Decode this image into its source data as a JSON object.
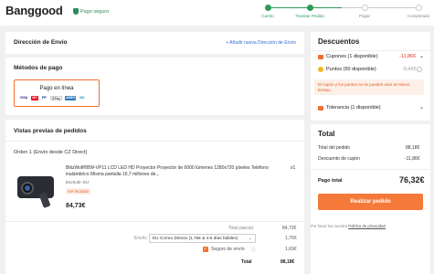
{
  "header": {
    "logo": "Banggood",
    "secure": "Pago seguro",
    "steps": [
      {
        "label": "Carrito",
        "state": "done"
      },
      {
        "label": "Tramitar Pedido",
        "state": "done"
      },
      {
        "label": "Pagar",
        "state": "todo"
      },
      {
        "label": "Completado",
        "state": "todo"
      }
    ]
  },
  "shipping": {
    "title": "Dirección de Envío",
    "add_link": "+ Añadir nueva Dirección de Envío"
  },
  "payment": {
    "title": "Métodos de pago",
    "option": "Pago en línea",
    "logos": [
      "VISA",
      "MC",
      "PP",
      "GPay",
      "AMEX",
      "DC"
    ]
  },
  "preview": {
    "title": "Vistas previas de pedidos",
    "order": "Orden 1 (Envío desde CZ Direct)",
    "product": {
      "name": "BlitzWolf®BW-VP11 LCD LED HD Proyector Proyector de 6000 lúmenes 1280x720 píxeles Teléfono inalámbrico Misma pantalla 16,7 millones de...",
      "qty": "x1",
      "seller": "Enchufe: EU",
      "tax_tag": "IVA incluido",
      "price": "84,73€"
    },
    "subtotal_label": "Total parcial:",
    "subtotal_value": "84,73€",
    "shipping_label": "Envío:",
    "shipping_option": "EU Correo Directo (1,76€ & 4-6 días hábiles)",
    "shipping_value": "1,76€",
    "insurance_label": "Seguro de envío",
    "insurance_value": "1,69€",
    "total_label": "Total",
    "total_value": "88,18€"
  },
  "discounts": {
    "title": "Descuentos",
    "coupons_label": "Cupones (1 disponible)",
    "coupons_value": "-11,86€",
    "points_label": "Puntos (50 disponible)",
    "points_value": "-0,42€",
    "warning": "El cupón y los puntos no se pueden usar al mismo tiempo.",
    "tolerance_label": "Tolerancia (1 disponible)"
  },
  "totals": {
    "title": "Total",
    "order_total_label": "Total del pedido",
    "order_total_value": "88,18€",
    "coupon_discount_label": "Descuento de cupón",
    "coupon_discount_value": "-11,86€",
    "pay_total_label": "Pago total",
    "pay_total_value": "76,32€",
    "button": "Realizar pedido",
    "privacy_prefix": "Por favor lea nuestra",
    "privacy_link": "Política de privacidad"
  },
  "colors": {
    "accent": "#f57a3a",
    "success": "#2e9a5a",
    "link": "#2f6fd1"
  }
}
